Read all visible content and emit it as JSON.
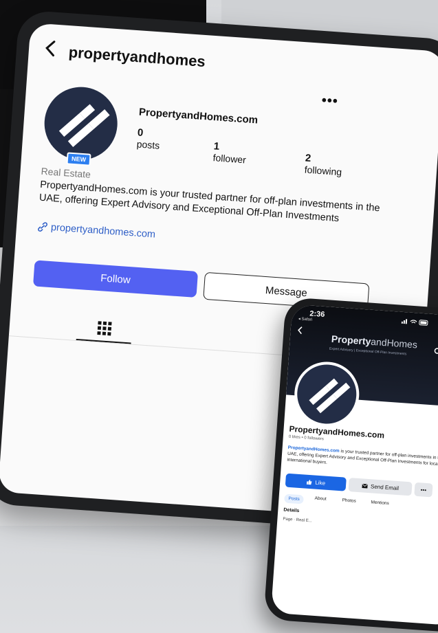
{
  "tablet": {
    "back_icon": "chevron-left-icon",
    "username": "propertyandhomes",
    "more_label": "•••",
    "new_badge": "NEW",
    "display_name": "PropertyandHomes.com",
    "stats": [
      {
        "value": "0",
        "label": "posts"
      },
      {
        "value": "1",
        "label": "follower"
      },
      {
        "value": "2",
        "label": "following"
      }
    ],
    "category": "Real Estate",
    "bio": "PropertyandHomes.com is your trusted partner for off-plan investments in the UAE, offering Expert Advisory and Exceptional Off-Plan Investments",
    "link": "propertyandhomes.com",
    "follow_label": "Follow",
    "message_label": "Message",
    "accent": "#5361f2"
  },
  "phone": {
    "time": "2:36",
    "carrier": "◂ Safari",
    "brand_bold": "Property",
    "brand_light": "andHomes",
    "tagline": "Expert Advisory | Exceptional Off-Plan Investments",
    "page_name": "PropertyandHomes.com",
    "meta": "0 likes  •  0 followers",
    "bio_link": "PropertyandHomes.com",
    "bio_rest": " is your trusted partner for off-plan investments in the UAE, offering Expert Advisory and Exceptional Off-Plan Investments for local & international buyers.",
    "like_label": "Like",
    "email_label": "Send Email",
    "more_label": "•••",
    "tabs": [
      "Posts",
      "About",
      "Photos",
      "Mentions"
    ],
    "details_label": "Details",
    "page_info": "Page · Real E..."
  }
}
